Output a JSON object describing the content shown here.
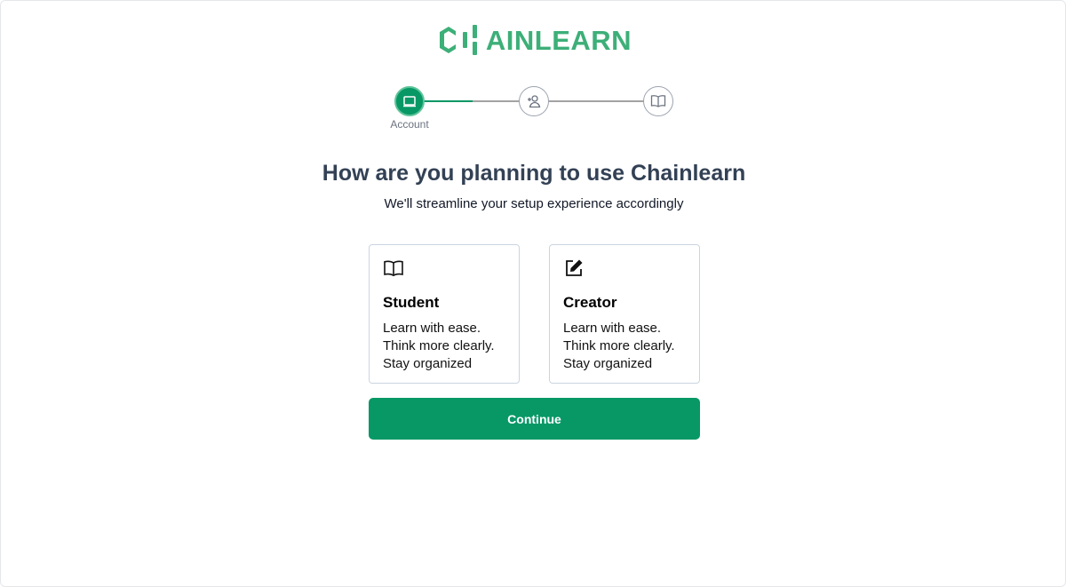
{
  "brand": {
    "name": "AINLEARN",
    "color": "#3daf78"
  },
  "stepper": {
    "steps": [
      {
        "label": "Account",
        "icon": "laptop-icon",
        "state": "active"
      },
      {
        "label": "",
        "icon": "user-plus-icon",
        "state": "pending"
      },
      {
        "label": "",
        "icon": "book-open-icon",
        "state": "pending"
      }
    ],
    "progress_first_segment": 0.5,
    "active_color": "#079866"
  },
  "heading": "How are you planning to use Chainlearn",
  "subheading": "We'll streamline your setup experience accordingly",
  "options": [
    {
      "icon": "book-open-icon",
      "title": "Student",
      "lines": [
        "Learn with ease.",
        "Think more clearly.",
        "Stay organized"
      ]
    },
    {
      "icon": "edit-icon",
      "title": "Creator",
      "lines": [
        "Learn with ease.",
        "Think more clearly.",
        "Stay organized"
      ]
    }
  ],
  "continue_label": "Continue"
}
